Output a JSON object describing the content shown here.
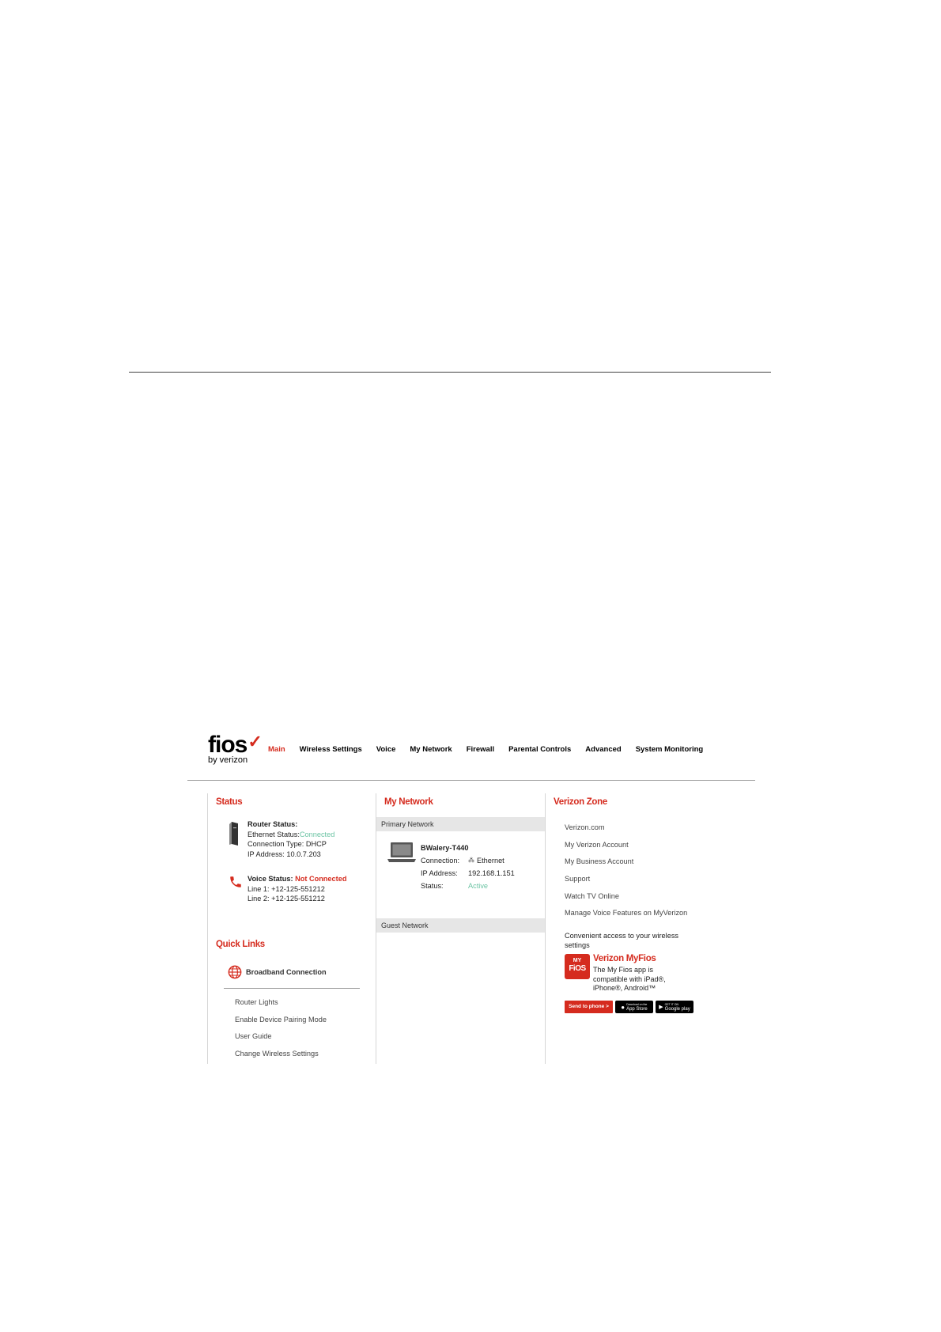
{
  "header": {
    "logo_word": "fios",
    "logo_by": "by verizon",
    "nav": [
      "Main",
      "Wireless Settings",
      "Voice",
      "My Network",
      "Firewall",
      "Parental Controls",
      "Advanced",
      "System Monitoring"
    ],
    "active_nav": "Main"
  },
  "status": {
    "title": "Status",
    "router_status_label": "Router Status:",
    "ethernet_status_label": "Ethernet Status:",
    "ethernet_status_value": "Connected",
    "connection_type": "Connection Type: DHCP",
    "ip_address": "IP Address: 10.0.7.203",
    "voice_status_label": "Voice Status:",
    "voice_status_value": "Not Connected",
    "line1": "Line 1: +12-125-551212",
    "line2": "Line 2: +12-125-551212"
  },
  "quick_links": {
    "title": "Quick Links",
    "broadband": "Broadband Connection",
    "links": [
      "Router Lights",
      "Enable Device Pairing Mode",
      "User Guide",
      "Change Wireless Settings"
    ]
  },
  "my_network": {
    "title": "My Network",
    "primary_label": "Primary Network",
    "guest_label": "Guest Network",
    "device": {
      "name": "BWalery-T440",
      "connection_label": "Connection:",
      "connection_value": "Ethernet",
      "ip_label": "IP Address:",
      "ip_value": "192.168.1.151",
      "status_label": "Status:",
      "status_value": "Active"
    }
  },
  "verizon_zone": {
    "title": "Verizon Zone",
    "links": [
      "Verizon.com",
      "My Verizon Account",
      "My Business Account",
      "Support",
      "Watch TV Online",
      "Manage Voice Features on MyVerizon"
    ],
    "note": "Convenient access to your wireless settings",
    "myfios_badge_top": "MY",
    "myfios_badge_bottom": "FiOS",
    "myfios_title": "Verizon MyFios",
    "myfios_desc": "The My Fios app is compatible with iPad®, iPhone®, Android™",
    "send_to_phone": "Send to phone  >",
    "app_store_small": "Download on the",
    "app_store": "App Store",
    "google_play_small": "GET IT ON",
    "google_play": "Google play"
  },
  "colors": {
    "accent": "#d52b1e",
    "status_green": "#6cc4a4"
  }
}
